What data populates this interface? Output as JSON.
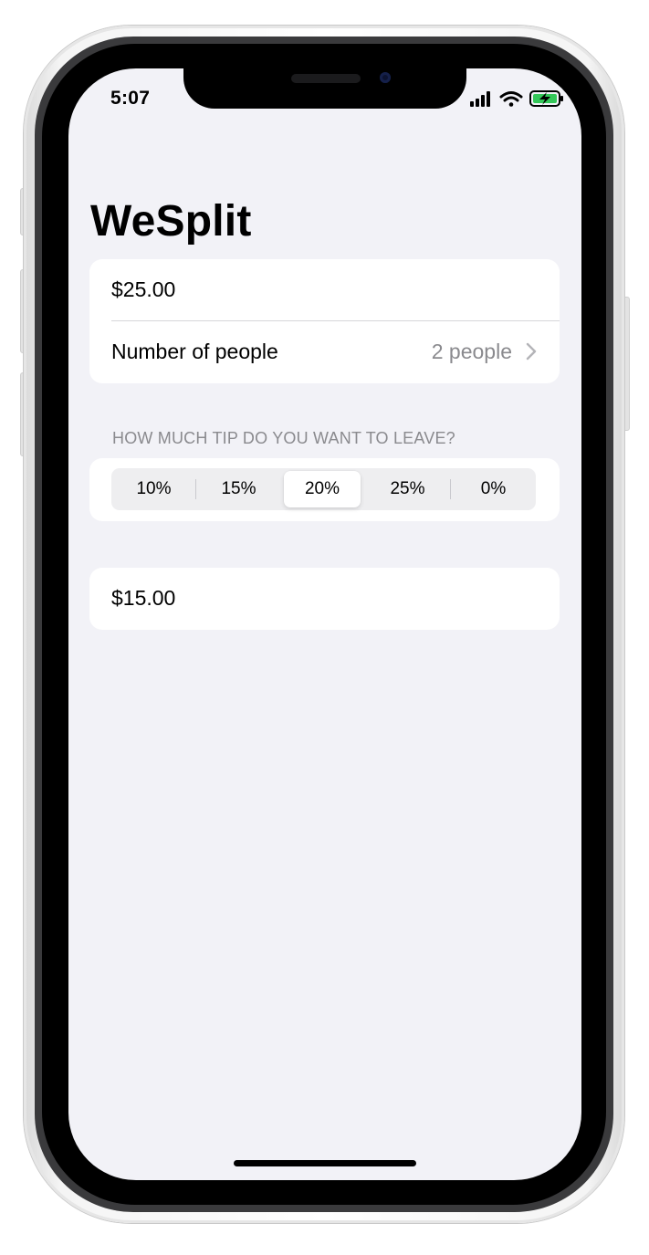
{
  "status_bar": {
    "time": "5:07",
    "icons": [
      "cellular-signal-icon",
      "wifi-icon",
      "battery-charging-icon"
    ]
  },
  "app": {
    "title": "WeSplit"
  },
  "form": {
    "check_amount": "$25.00",
    "people_label": "Number of people",
    "people_value": "2 people"
  },
  "tip": {
    "header": "HOW MUCH TIP DO YOU WANT TO LEAVE?",
    "options": [
      "10%",
      "15%",
      "20%",
      "25%",
      "0%"
    ],
    "selected": "20%"
  },
  "total": {
    "amount_per_person": "$15.00"
  },
  "colors": {
    "background": "#f2f2f7",
    "card": "#ffffff",
    "secondary_text": "#8a8a8e",
    "battery_charging": "#34c759"
  }
}
